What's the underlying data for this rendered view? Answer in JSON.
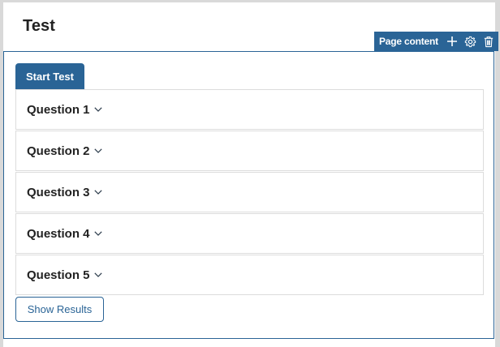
{
  "page": {
    "title": "Test"
  },
  "toolbar": {
    "label": "Page content",
    "icons": [
      "plus-icon",
      "gear-icon",
      "trash-icon"
    ]
  },
  "actions": {
    "start_label": "Start Test",
    "results_label": "Show Results"
  },
  "questions": [
    {
      "label": "Question 1"
    },
    {
      "label": "Question 2"
    },
    {
      "label": "Question 3"
    },
    {
      "label": "Question 4"
    },
    {
      "label": "Question 5"
    }
  ],
  "colors": {
    "accent": "#2a6496",
    "text": "#222222",
    "border": "#dcdcdc",
    "background": "#d9d9d9"
  }
}
